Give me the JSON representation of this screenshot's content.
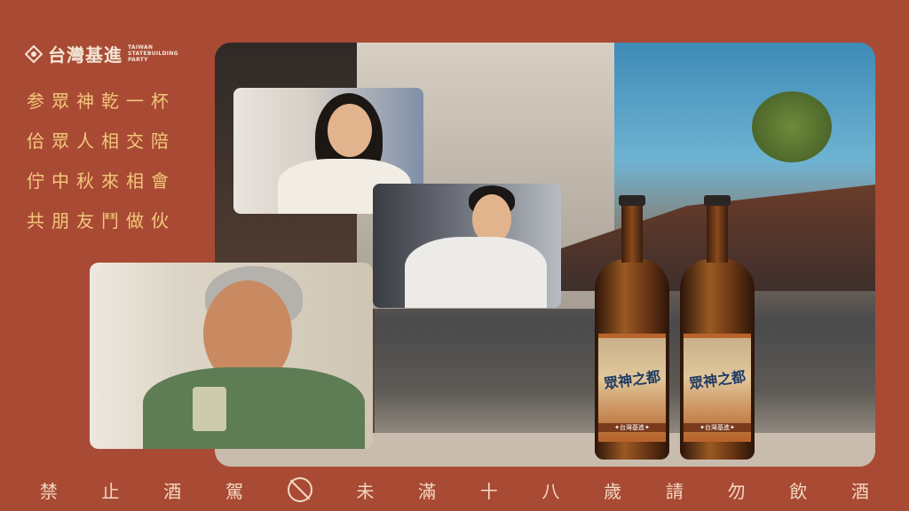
{
  "logo": {
    "title": "台灣基進",
    "subtitle_lines": [
      "TAIWAN",
      "STATEBUILDING",
      "PARTY"
    ]
  },
  "poem": {
    "lines": [
      "参眾神乾一杯",
      "佮眾人相交陪",
      "佇中秋來相會",
      "共朋友鬥做伙"
    ]
  },
  "bottles": [
    {
      "label": "眾神之都",
      "brand": "✦台灣基進✦"
    },
    {
      "label": "眾神之都",
      "brand": "✦台灣基進✦"
    }
  ],
  "footer": {
    "left_chars": [
      "禁",
      "止",
      "酒",
      "駕"
    ],
    "icon": "no-drinking-icon",
    "right_chars": [
      "未",
      "滿",
      "十",
      "八",
      "歲",
      "請",
      "勿",
      "飲",
      "酒"
    ]
  },
  "colors": {
    "background": "#A94A35",
    "poem_text": "#F2C87A",
    "footer_text": "#F2D9C2"
  }
}
